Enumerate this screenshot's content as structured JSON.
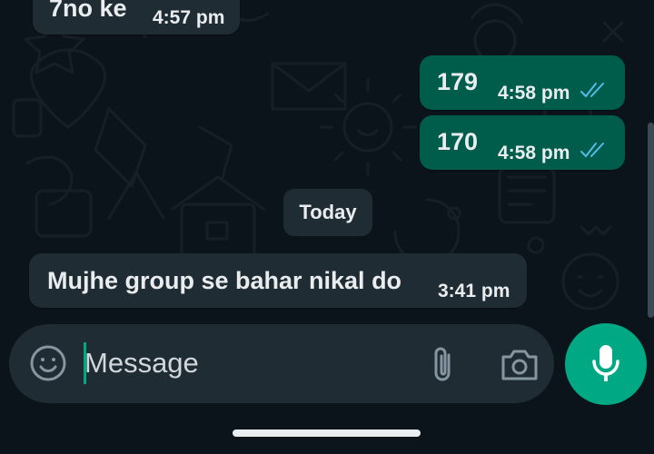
{
  "colors": {
    "background": "#0b141a",
    "incoming_bubble": "#202c33",
    "outgoing_bubble": "#005c4b",
    "accent": "#00a884",
    "read_ticks": "#53bdeb",
    "text": "#e9edef"
  },
  "messages": [
    {
      "direction": "incoming",
      "text": "7no ke",
      "time": "4:57 pm"
    },
    {
      "direction": "outgoing",
      "text": "179",
      "time": "4:58 pm",
      "status": "read"
    },
    {
      "direction": "outgoing",
      "text": "170",
      "time": "4:58 pm",
      "status": "read"
    },
    {
      "direction": "incoming",
      "text": "Mujhe group se bahar nikal do",
      "time": "3:41 pm"
    }
  ],
  "date_separator": "Today",
  "composer": {
    "placeholder": "Message",
    "emoji_icon": "emoji-icon",
    "attach_icon": "paperclip-icon",
    "camera_icon": "camera-icon",
    "mic_icon": "microphone-icon"
  }
}
